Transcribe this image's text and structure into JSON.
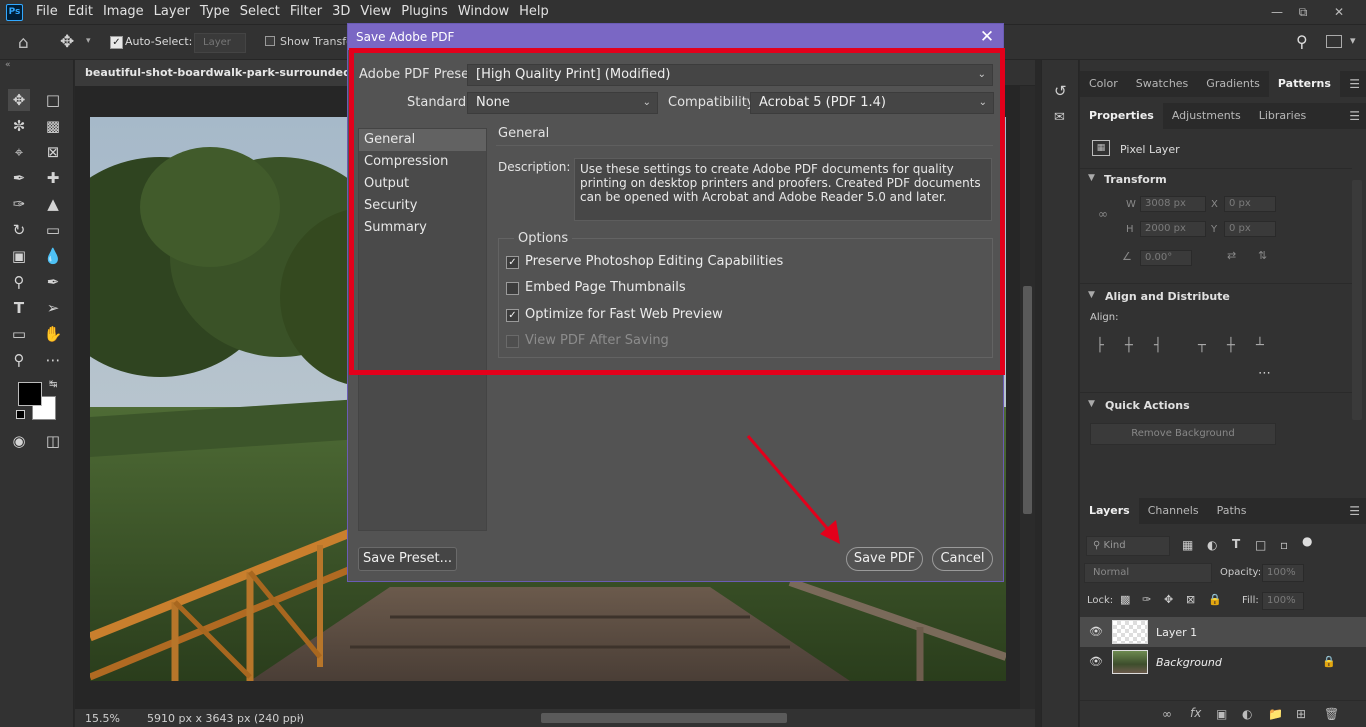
{
  "menubar": {
    "logo": "Ps",
    "items": [
      "File",
      "Edit",
      "Image",
      "Layer",
      "Type",
      "Select",
      "Filter",
      "3D",
      "View",
      "Plugins",
      "Window",
      "Help"
    ]
  },
  "optbar": {
    "auto_select_label": "Auto-Select:",
    "auto_select_value": "Layer",
    "show_transform_label": "Show Transfor"
  },
  "document": {
    "tab_title": "beautiful-shot-boardwalk-park-surrounded-by-tall",
    "zoom": "15.5%",
    "dimensions": "5910 px x 3643 px (240 ppi)"
  },
  "dialog": {
    "title": "Save Adobe PDF",
    "preset_label": "Adobe PDF Preset:",
    "preset_value": "[High Quality Print] (Modified)",
    "standard_label": "Standard:",
    "standard_value": "None",
    "compat_label": "Compatibility:",
    "compat_value": "Acrobat 5 (PDF 1.4)",
    "nav": [
      "General",
      "Compression",
      "Output",
      "Security",
      "Summary"
    ],
    "section_title": "General",
    "description_label": "Description:",
    "description": "Use these settings to create Adobe PDF documents for quality printing on desktop printers and proofers.  Created PDF documents can be opened with Acrobat and Adobe Reader 5.0 and later.",
    "options_title": "Options",
    "options": [
      {
        "label": "Preserve Photoshop Editing Capabilities",
        "checked": true,
        "disabled": false
      },
      {
        "label": "Embed Page Thumbnails",
        "checked": false,
        "disabled": false
      },
      {
        "label": "Optimize for Fast Web Preview",
        "checked": true,
        "disabled": false
      },
      {
        "label": "View PDF After Saving",
        "checked": false,
        "disabled": true
      }
    ],
    "save_preset_label": "Save Preset...",
    "save_label": "Save PDF",
    "cancel_label": "Cancel"
  },
  "panels": {
    "top_tabs": [
      "Color",
      "Swatches",
      "Gradients",
      "Patterns"
    ],
    "prop_tabs": [
      "Properties",
      "Adjustments",
      "Libraries"
    ],
    "pixel_layer": "Pixel Layer",
    "transform_title": "Transform",
    "w_label": "W",
    "w_value": "3008 px",
    "x_label": "X",
    "x_value": "0 px",
    "h_label": "H",
    "h_value": "2000 px",
    "y_label": "Y",
    "y_value": "0 px",
    "angle_value": "0.00°",
    "align_title": "Align and Distribute",
    "align_label": "Align:",
    "quick_actions_title": "Quick Actions",
    "remove_bg_label": "Remove Background",
    "layer_tabs": [
      "Layers",
      "Channels",
      "Paths"
    ],
    "kind_label": "Kind",
    "blend_mode": "Normal",
    "opacity_label": "Opacity:",
    "opacity_value": "100%",
    "lock_label": "Lock:",
    "fill_label": "Fill:",
    "fill_value": "100%",
    "layers": [
      "Layer 1",
      "Background"
    ]
  },
  "colors": {
    "accent_title": "#7a67c4",
    "highlight_box": "#e3001b",
    "arrow": "#e3001b"
  }
}
